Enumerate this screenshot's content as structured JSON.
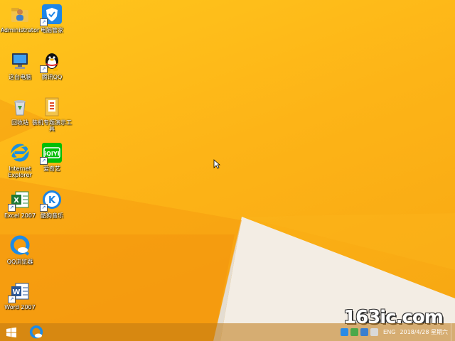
{
  "desktop": {
    "icons": [
      {
        "label": "Administrator",
        "icon": "user-folder-icon"
      },
      {
        "label": "电脑管家",
        "icon": "pc-manager-shield-icon"
      },
      {
        "label": "这台电脑",
        "icon": "computer-icon"
      },
      {
        "label": "腾讯QQ",
        "icon": "qq-penguin-icon"
      },
      {
        "label": "回收站",
        "icon": "recycle-bin-icon"
      },
      {
        "label": "装机专题演示工具",
        "icon": "tool-folder-icon"
      },
      {
        "label": "Internet Explorer",
        "icon": "internet-explorer-icon"
      },
      {
        "label": "爱奇艺",
        "icon": "iqiyi-icon"
      },
      {
        "label": "Excel 2007",
        "icon": "excel-icon"
      },
      {
        "label": "酷狗音乐",
        "icon": "kugou-icon"
      },
      {
        "label": "QQ浏览器",
        "icon": "qq-browser-icon"
      },
      {
        "label": "Word 2007",
        "icon": "word-icon"
      }
    ],
    "iqiyi_text": "iQIYI",
    "kugou_letter": "K"
  },
  "watermark": "163ic.com",
  "taskbar": {
    "start_icon": "windows-logo-icon",
    "pinned_icon": "qq-browser-icon",
    "tray": {
      "language": "ENG",
      "date": "2018/4/28 星期六"
    }
  },
  "colors": {
    "wallpaper": "#fdb417",
    "taskbar": "#be7814"
  }
}
